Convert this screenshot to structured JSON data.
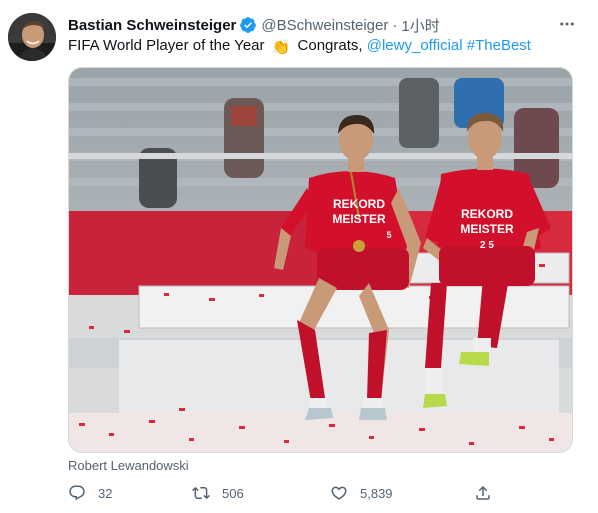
{
  "author": {
    "name": "Bastian Schweinsteiger",
    "handle": "@BSchweinsteiger",
    "separator": "·",
    "time": "1小时",
    "verified": true,
    "avatar_icon": "avatar-photo"
  },
  "tweet": {
    "text_before": "FIFA World Player of the Year",
    "emoji": "👏",
    "text_middle": "Congrats,",
    "mention": "@lewy_official",
    "hashtag": "#TheBest",
    "link_color": "#1d9bf0"
  },
  "media": {
    "jersey_text_1": "REKORD",
    "jersey_text_2": "MEISTER",
    "number_left": "5",
    "number_right": "2 5"
  },
  "media_caption": "Robert Lewandowski",
  "actions": {
    "reply_count": "32",
    "retweet_count": "506",
    "like_count": "5,839"
  },
  "colors": {
    "jersey_red": "#d2102c",
    "stand_blue": "#2f6fb0"
  }
}
